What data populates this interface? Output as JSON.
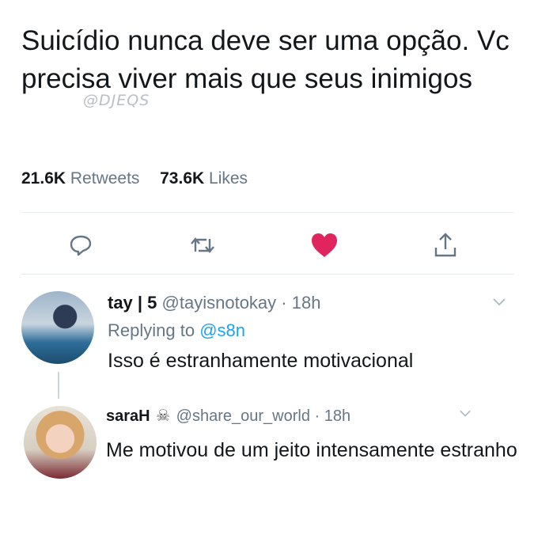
{
  "tweet": {
    "text": "Suicídio nunca deve ser uma opção. Vc precisa viver mais que seus inimigos",
    "watermark": "@DJEQS",
    "retweets_count": "21.6K",
    "retweets_label": "Retweets",
    "likes_count": "73.6K",
    "likes_label": "Likes"
  },
  "actions": {
    "reply_icon": "reply-icon",
    "retweet_icon": "retweet-icon",
    "like_icon": "heart-icon",
    "share_icon": "share-icon",
    "like_color": "#e0245e",
    "icon_color": "#657786"
  },
  "replies": [
    {
      "name": "tay | 5",
      "handle": "@tayisnotokay",
      "time": "· 18h",
      "replying_prefix": "Replying to",
      "replying_handle": "@s8n",
      "text": "Isso é estranhamente motivacional"
    },
    {
      "name": "saraH",
      "emoji": "☠",
      "handle": "@share_our_world",
      "time": "· 18h",
      "text": "Me motivou de um jeito intensamente estranho"
    }
  ]
}
